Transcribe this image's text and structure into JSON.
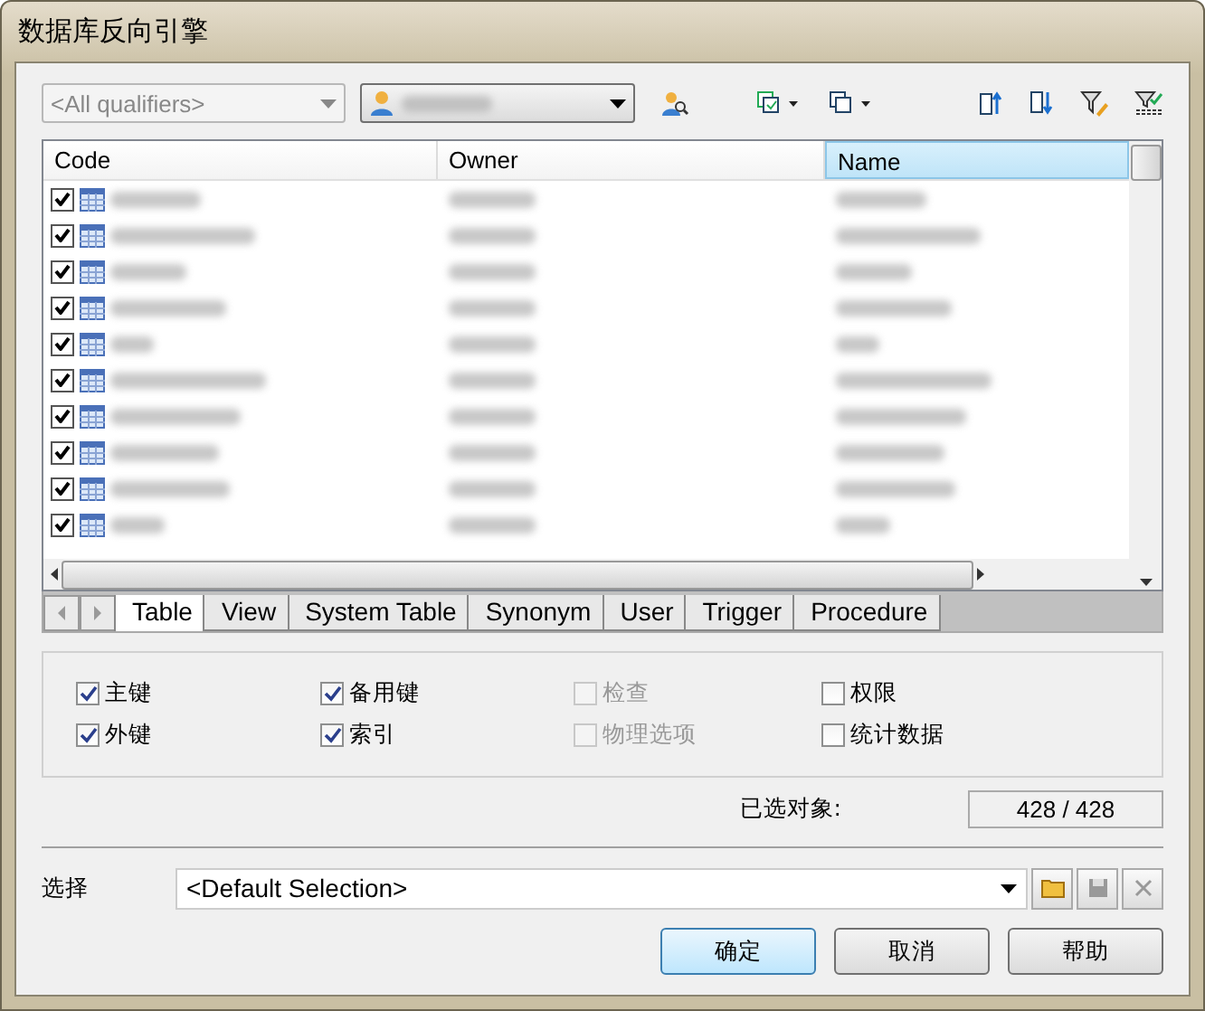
{
  "window": {
    "title": "数据库反向引擎"
  },
  "toolbar": {
    "qualifier": {
      "value": "<All qualifiers>",
      "disabled": true
    }
  },
  "table": {
    "columns": [
      {
        "label": "Code",
        "selected": false
      },
      {
        "label": "Owner",
        "selected": false
      },
      {
        "label": "Name",
        "selected": true
      }
    ],
    "rows": [
      {
        "checked": true
      },
      {
        "checked": true
      },
      {
        "checked": true
      },
      {
        "checked": true
      },
      {
        "checked": true
      },
      {
        "checked": true
      },
      {
        "checked": true
      },
      {
        "checked": true
      },
      {
        "checked": true
      },
      {
        "checked": true
      }
    ]
  },
  "tabs": [
    {
      "label": "Table",
      "selected": true
    },
    {
      "label": "View",
      "selected": false
    },
    {
      "label": "System Table",
      "selected": false
    },
    {
      "label": "Synonym",
      "selected": false
    },
    {
      "label": "User",
      "selected": false
    },
    {
      "label": "Trigger",
      "selected": false
    },
    {
      "label": "Procedure",
      "selected": false
    }
  ],
  "options": [
    {
      "label": "主键",
      "checked": true,
      "disabled": false
    },
    {
      "label": "备用键",
      "checked": true,
      "disabled": false
    },
    {
      "label": "检查",
      "checked": false,
      "disabled": true
    },
    {
      "label": "权限",
      "checked": false,
      "disabled": false
    },
    {
      "label": "外键",
      "checked": true,
      "disabled": false
    },
    {
      "label": "索引",
      "checked": true,
      "disabled": false
    },
    {
      "label": "物理选项",
      "checked": false,
      "disabled": true
    },
    {
      "label": "统计数据",
      "checked": false,
      "disabled": false
    }
  ],
  "selected_objects": {
    "label": "已选对象:",
    "value": "428 / 428"
  },
  "selection": {
    "label": "选择",
    "value": "<Default Selection>"
  },
  "buttons": [
    {
      "label": "确定",
      "selected": true
    },
    {
      "label": "取消",
      "selected": false
    },
    {
      "label": "帮助",
      "selected": false
    }
  ]
}
